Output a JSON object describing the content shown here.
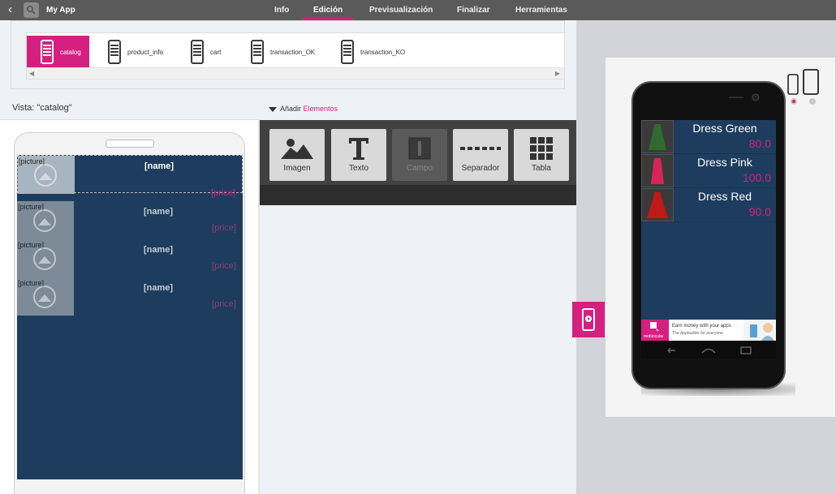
{
  "app": {
    "name": "My App"
  },
  "nav": {
    "tabs": [
      "Info",
      "Edición",
      "Previsualización",
      "Finalizar",
      "Herramientas"
    ],
    "active": "Edición"
  },
  "screens": [
    "catalog",
    "product_info",
    "cart",
    "transaction_OK",
    "transaction_KO"
  ],
  "vista_label": "Vista: \"catalog\"",
  "add_elements": {
    "prefix": "Añadir",
    "link": "Elementos"
  },
  "editor_rows": [
    {
      "picture": "[picture]",
      "name": "[name]",
      "price": "[price]"
    },
    {
      "picture": "[picture]",
      "name": "[name]",
      "price": "[price]"
    },
    {
      "picture": "[picture]",
      "name": "[name]",
      "price": "[price]"
    },
    {
      "picture": "[picture]",
      "name": "[name]",
      "price": "[price]"
    }
  ],
  "tools": [
    "Imagen",
    "Texto",
    "Campo",
    "Separador",
    "Tabla"
  ],
  "preview_items": [
    {
      "name": "Dress Green",
      "price": "80.0",
      "color": "#2f6b2f"
    },
    {
      "name": "Dress Pink",
      "price": "100.0",
      "color": "#d8245a"
    },
    {
      "name": "Dress Red",
      "price": "90.0",
      "color": "#c11818"
    }
  ],
  "ad": {
    "brand": "mobincube",
    "line1": "Earn money with your apps",
    "line2": "The Appbuilder for everyone"
  },
  "colors": {
    "accent": "#d6207f",
    "screen_bg": "#1e3d5e",
    "topbar": "#5a5a5a"
  }
}
